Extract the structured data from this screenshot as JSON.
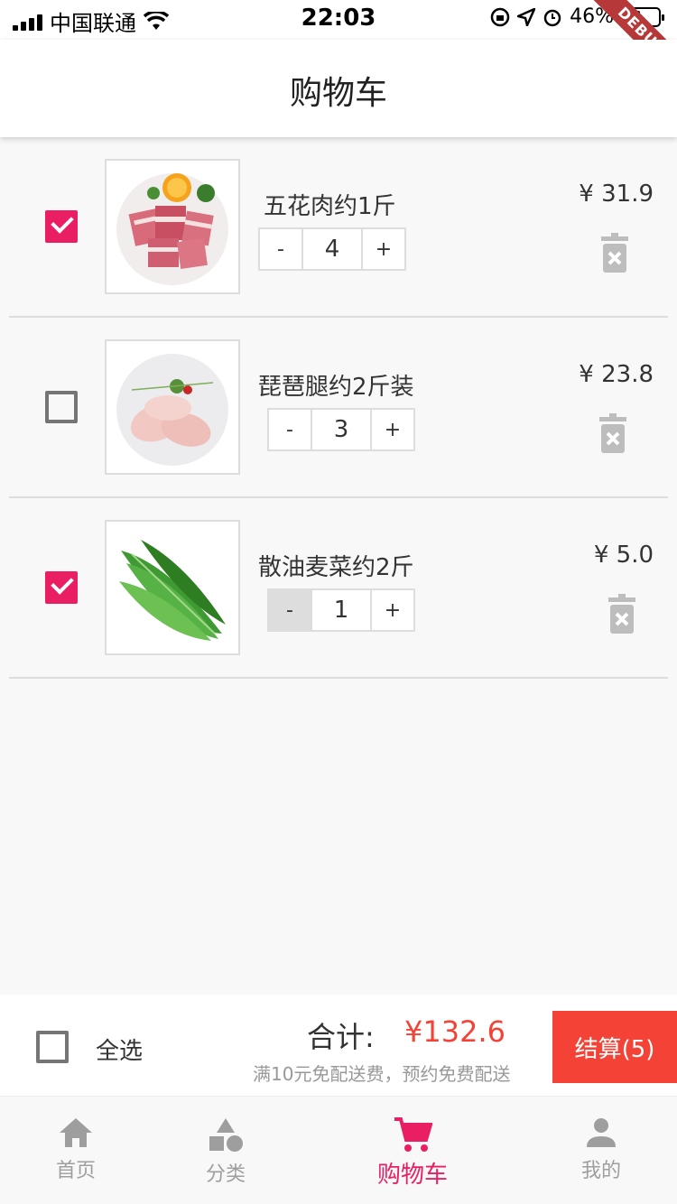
{
  "status_bar": {
    "carrier": "中国联通",
    "time": "22:03",
    "battery": "46%",
    "debug": "DEBUG"
  },
  "header": {
    "title": "购物车"
  },
  "cart": {
    "items": [
      {
        "name": "五花肉约1斤",
        "qty": "4",
        "price": "¥ 31.9",
        "checked": true,
        "dec": "-",
        "inc": "+"
      },
      {
        "name": "琵琶腿约2斤装",
        "qty": "3",
        "price": "¥ 23.8",
        "checked": false,
        "dec": "-",
        "inc": "+"
      },
      {
        "name": "散油麦菜约2斤",
        "qty": "1",
        "price": "¥ 5.0",
        "checked": true,
        "dec": "-",
        "inc": "+"
      }
    ]
  },
  "footer": {
    "select_all": "全选",
    "total_label": "合计:",
    "total": "¥132.6",
    "note": "满10元免配送费，预约免费配送",
    "checkout": "结算(5)"
  },
  "tabs": [
    {
      "label": "首页",
      "icon": "home-icon"
    },
    {
      "label": "分类",
      "icon": "category-icon"
    },
    {
      "label": "购物车",
      "icon": "cart-icon",
      "active": true
    },
    {
      "label": "我的",
      "icon": "person-icon"
    }
  ],
  "colors": {
    "accent": "#e91e63",
    "price_red": "#f44336",
    "inactive": "#9e9e9e"
  }
}
